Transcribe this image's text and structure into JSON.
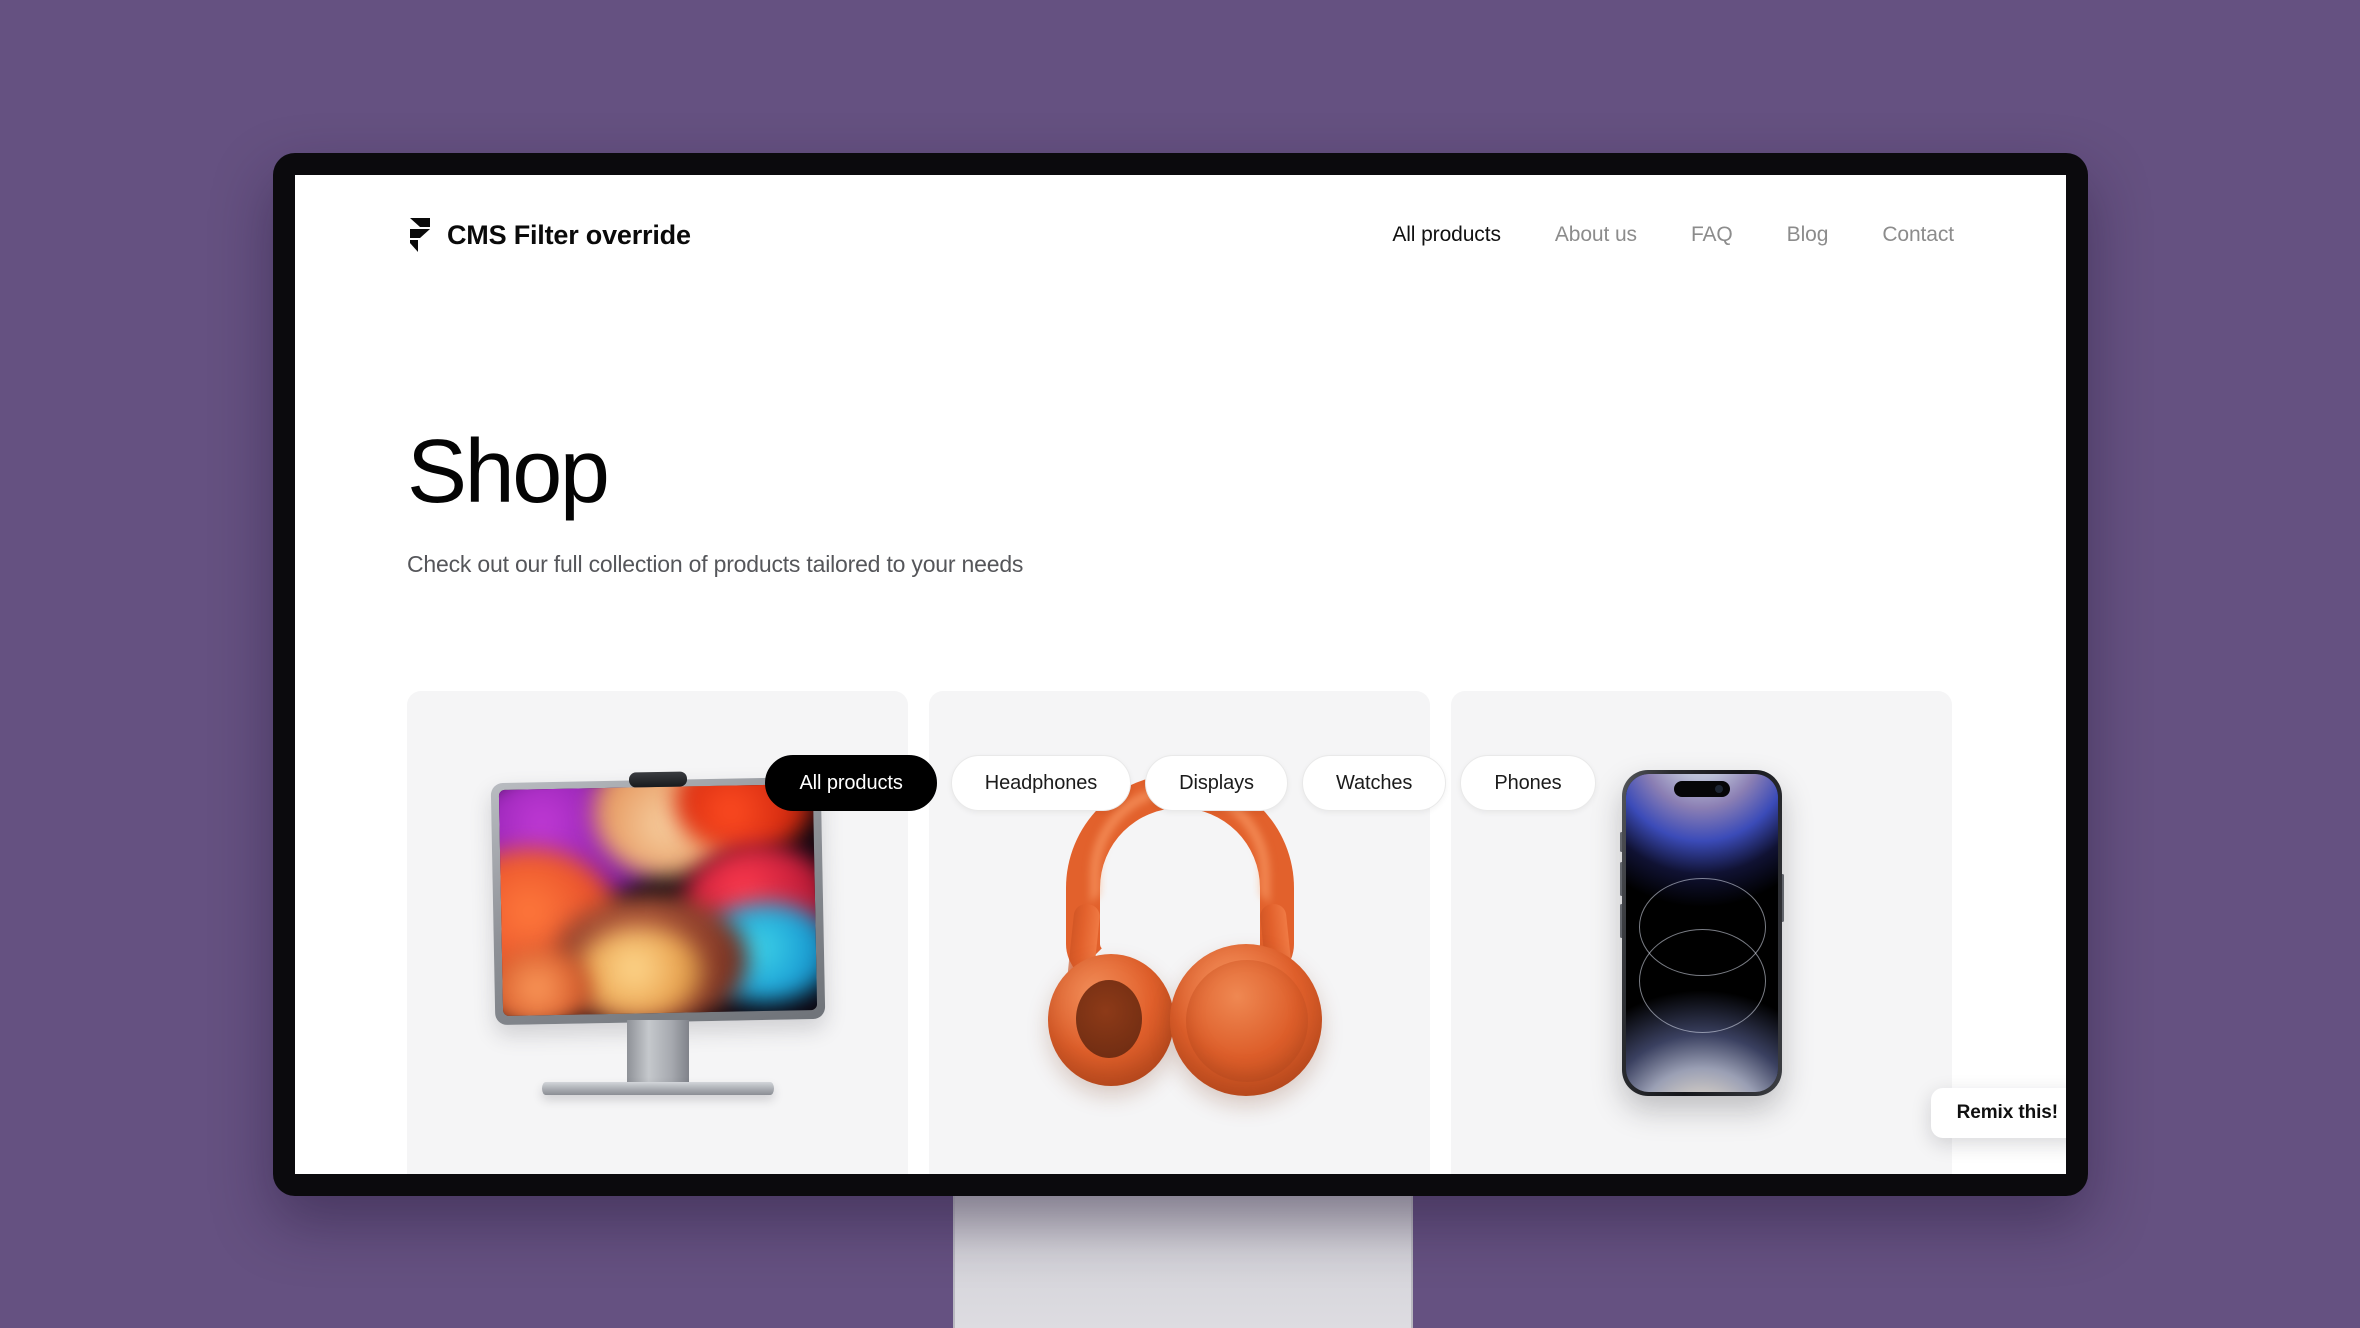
{
  "scene": {
    "background_color": "#655181",
    "device": "desktop-monitor",
    "bezel_color": "#0b0a0d",
    "stand_color": "#d4d3d9"
  },
  "site": {
    "header": {
      "logo_icon": "framer-f-icon",
      "brand_name": "CMS Filter override",
      "nav": [
        {
          "label": "All products",
          "active": true
        },
        {
          "label": "About us",
          "active": false
        },
        {
          "label": "FAQ",
          "active": false
        },
        {
          "label": "Blog",
          "active": false
        },
        {
          "label": "Contact",
          "active": false
        }
      ]
    },
    "hero": {
      "title": "Shop",
      "subtitle": "Check out our full collection of products tailored to your needs"
    },
    "filters": [
      {
        "label": "All products",
        "active": true
      },
      {
        "label": "Headphones",
        "active": false
      },
      {
        "label": "Displays",
        "active": false
      },
      {
        "label": "Watches",
        "active": false
      },
      {
        "label": "Phones",
        "active": false
      }
    ],
    "products": [
      {
        "category": "Displays",
        "image": "studio-display-product-image"
      },
      {
        "category": "Headphones",
        "image": "orange-headphones-product-image"
      },
      {
        "category": "Phones",
        "image": "black-smartphone-product-image"
      }
    ],
    "remix_badge": {
      "label": "Remix this!"
    },
    "colors": {
      "accent_active_pill": "#000000",
      "text_primary": "#0a0a0a",
      "text_muted": "#8c8c8c",
      "card_background": "#f5f5f6",
      "page_background": "#ffffff"
    }
  }
}
